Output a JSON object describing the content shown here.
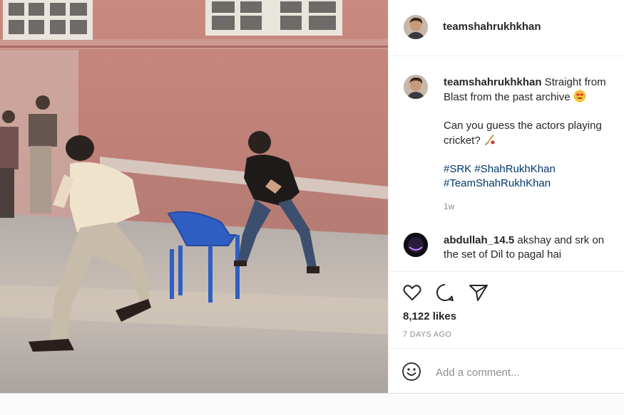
{
  "post": {
    "author": "teamshahrukhkhan",
    "caption": {
      "line1": "Straight from Blast from the past archive",
      "line1_emoji": "heart-eyes-emoji",
      "line2": "Can you guess the actors playing cricket?",
      "line2_emoji": "cricket-bat-emoji",
      "hashtags": [
        "#SRK",
        "#ShahRukhKhan",
        "#TeamShahRukhKhan"
      ],
      "time": "1w"
    },
    "comments": [
      {
        "author": "abdullah_14.5",
        "text": "akshay and srk on the set of Dil to pagal hai"
      }
    ],
    "likes": "8,122 likes",
    "ago": "7 DAYS AGO",
    "add_comment_placeholder": "Add a comment..."
  },
  "icons": {
    "like": "heart-icon",
    "comment": "comment-bubble-icon",
    "share": "paper-plane-icon",
    "emoji": "smiley-icon"
  },
  "colors": {
    "hashtag": "#00376b",
    "muted": "#8e8e8e",
    "text": "#262626"
  }
}
